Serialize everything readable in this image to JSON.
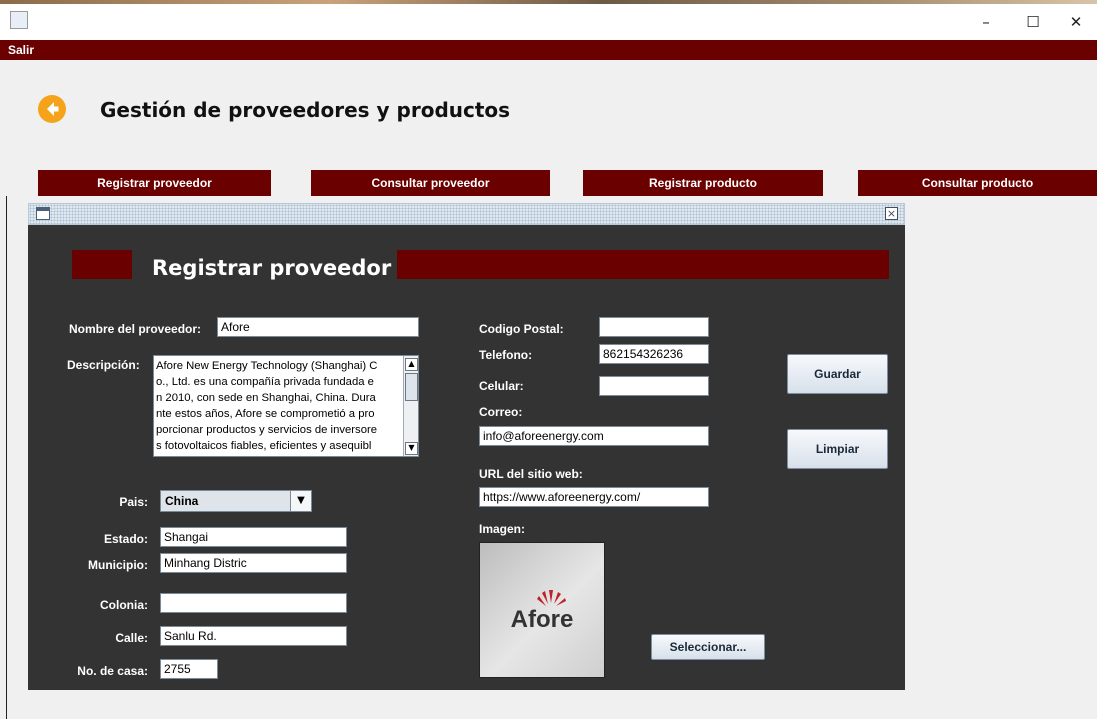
{
  "window": {
    "minimize_glyph": "–",
    "maximize_glyph": "☐",
    "close_glyph": "✕"
  },
  "menu": {
    "salir": "Salir"
  },
  "header": {
    "title": "Gestión de proveedores y productos",
    "back_icon": "arrow-left-circle-icon"
  },
  "nav": {
    "registrar_proveedor": "Registrar proveedor",
    "consultar_proveedor": "Consultar proveedor",
    "registrar_producto": "Registrar producto",
    "consultar_producto": "Consultar producto"
  },
  "form": {
    "title": "Registrar proveedor",
    "labels": {
      "nombre": "Nombre del proveedor:",
      "descripcion": "Descripción:",
      "pais": "Pais:",
      "estado": "Estado:",
      "municipio": "Municipio:",
      "colonia": "Colonia:",
      "calle": "Calle:",
      "no_casa": "No. de casa:",
      "codigo_postal": "Codigo Postal:",
      "telefono": "Telefono:",
      "celular": "Celular:",
      "correo": "Correo:",
      "url": "URL del sitio web:",
      "imagen": "Imagen:"
    },
    "values": {
      "nombre": "Afore",
      "descripcion_lines": [
        "Afore New Energy Technology (Shanghai) C",
        "o., Ltd. es una compañía privada fundada e",
        "n 2010, con sede en Shanghai, China. Dura",
        "nte estos años, Afore se comprometió a pro",
        "porcionar productos y servicios de inversore",
        "s fotovoltaicos fiables, eficientes y asequibl"
      ],
      "pais": "China",
      "estado": "Shangai",
      "municipio": "Minhang Distric",
      "colonia": "",
      "calle": "Sanlu Rd.",
      "no_casa": "2755",
      "codigo_postal": "",
      "telefono": "862154326236",
      "celular": "",
      "correo": "info@aforeenergy.com",
      "url": "https://www.aforeenergy.com/"
    },
    "logo_text": "Afore",
    "buttons": {
      "guardar": "Guardar",
      "limpiar": "Limpiar",
      "seleccionar": "Seleccionar..."
    }
  },
  "colors": {
    "accent": "#6b0000",
    "panel": "#333333",
    "back_icon": "#f5a31a"
  }
}
